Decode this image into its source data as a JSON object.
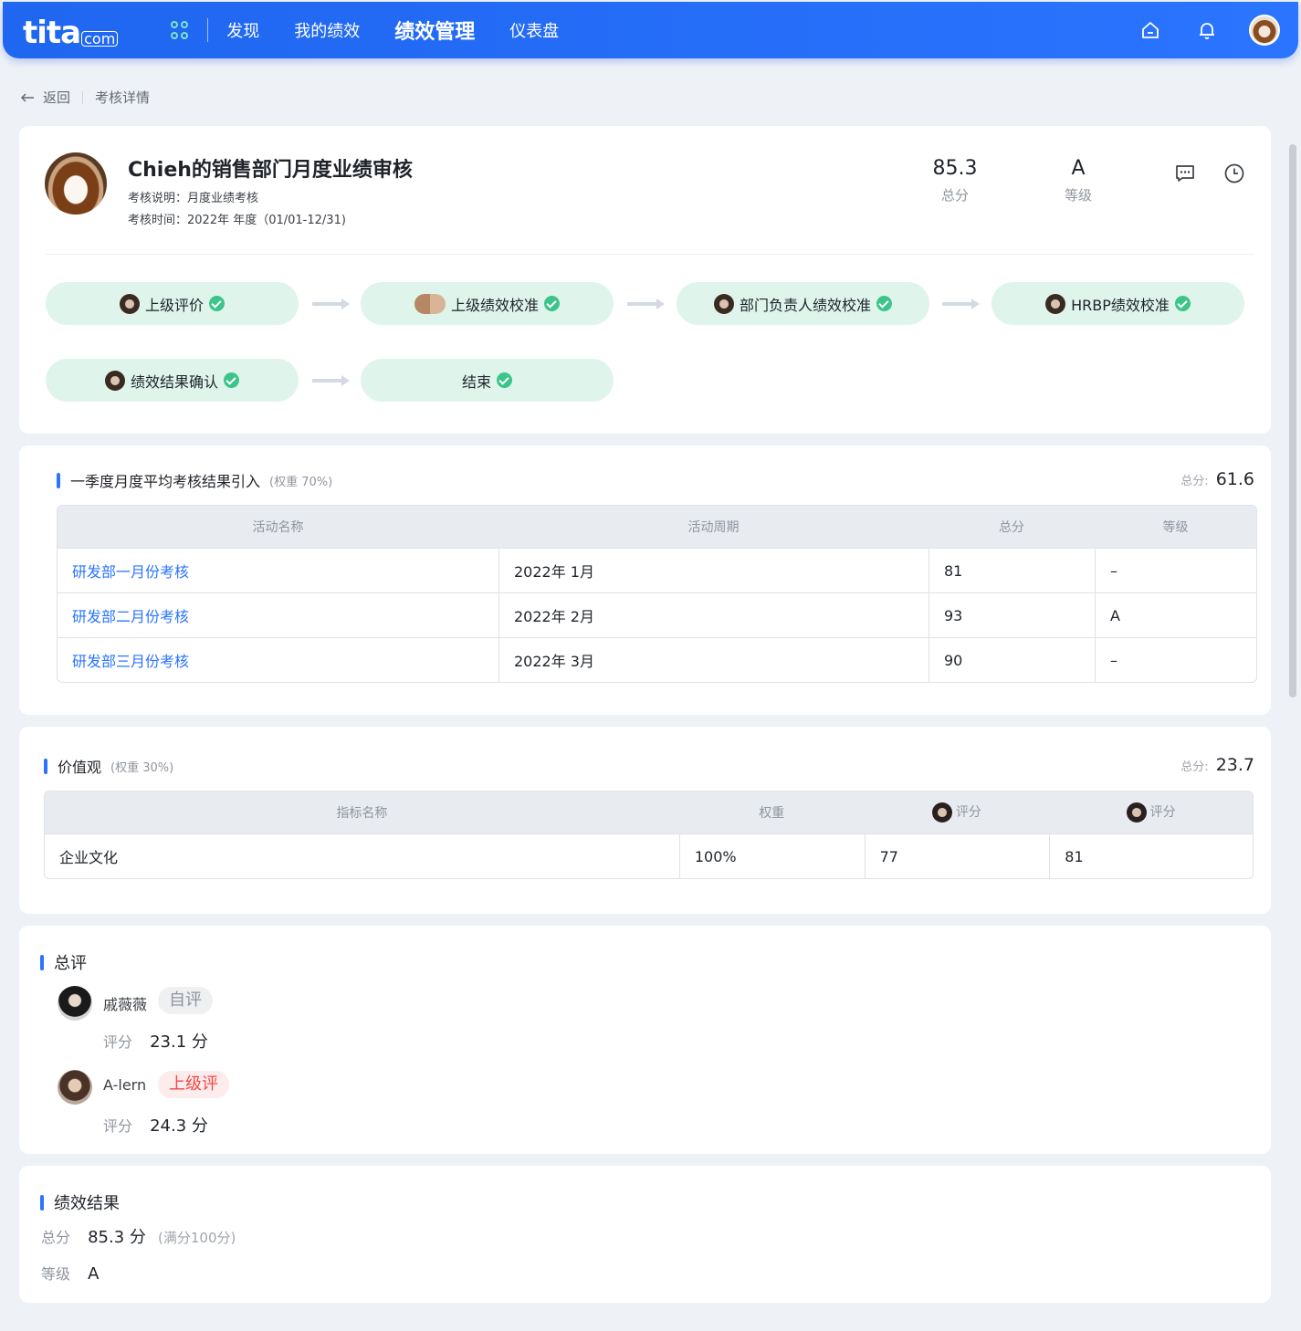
{
  "brand": {
    "logo_main": "tita",
    "logo_suffix": "com"
  },
  "nav": {
    "items": [
      "发现",
      "我的绩效",
      "绩效管理",
      "仪表盘"
    ],
    "active": "绩效管理"
  },
  "topbar_icons": [
    "home-icon",
    "bell-icon",
    "user-avatar"
  ],
  "breadcrumb": {
    "back": "返回",
    "current": "考核详情"
  },
  "header": {
    "title": "Chieh的销售部门月度业绩审核",
    "description": "考核说明：月度业绩考核",
    "period": "考核时间：2022年 年度（01/01-12/31)",
    "total_score": "85.3",
    "total_score_label": "总分",
    "grade": "A",
    "grade_label": "等级"
  },
  "workflow": {
    "steps": [
      {
        "label": "上级评价",
        "done": true
      },
      {
        "label": "上级绩效校准",
        "done": true
      },
      {
        "label": "部门负责人绩效校准",
        "done": true
      },
      {
        "label": "HRBP绩效校准",
        "done": true
      },
      {
        "label": "绩效结果确认",
        "done": true
      },
      {
        "label": "结束",
        "done": true
      }
    ]
  },
  "section_quarter": {
    "title": "一季度月度平均考核结果引入",
    "weight": "(权重 70%)",
    "total_label": "总分:",
    "total_value": "61.6",
    "columns": [
      "活动名称",
      "活动周期",
      "总分",
      "等级"
    ],
    "rows": [
      {
        "name": "研发部一月份考核",
        "period": "2022年 1月",
        "score": "81",
        "grade": "–"
      },
      {
        "name": "研发部二月份考核",
        "period": "2022年 2月",
        "score": "93",
        "grade": "A"
      },
      {
        "name": "研发部三月份考核",
        "period": "2022年 3月",
        "score": "90",
        "grade": "–"
      }
    ]
  },
  "section_values": {
    "title": "价值观",
    "weight": "(权重 30%)",
    "total_label": "总分:",
    "total_value": "23.7",
    "columns": [
      "指标名称",
      "权重",
      "评分",
      "评分"
    ],
    "rows": [
      {
        "name": "企业文化",
        "weight": "100%",
        "score1": "77",
        "score2": "81"
      }
    ]
  },
  "section_review": {
    "title": "总评",
    "reviewers": [
      {
        "name": "戚薇薇",
        "tag": "自评",
        "score_label": "评分",
        "score": "23.1 分"
      },
      {
        "name": "A-lern",
        "tag": "上级评",
        "score_label": "评分",
        "score": "24.3 分"
      }
    ]
  },
  "section_result": {
    "title": "绩效结果",
    "total_label": "总分",
    "total_value": "85.3 分",
    "total_note": "(满分100分)",
    "grade_label": "等级",
    "grade_value": "A"
  },
  "colors": {
    "primary": "#2a74ff",
    "step_bg": "#dff5ec",
    "check": "#3dc48a",
    "danger": "#f04848"
  }
}
